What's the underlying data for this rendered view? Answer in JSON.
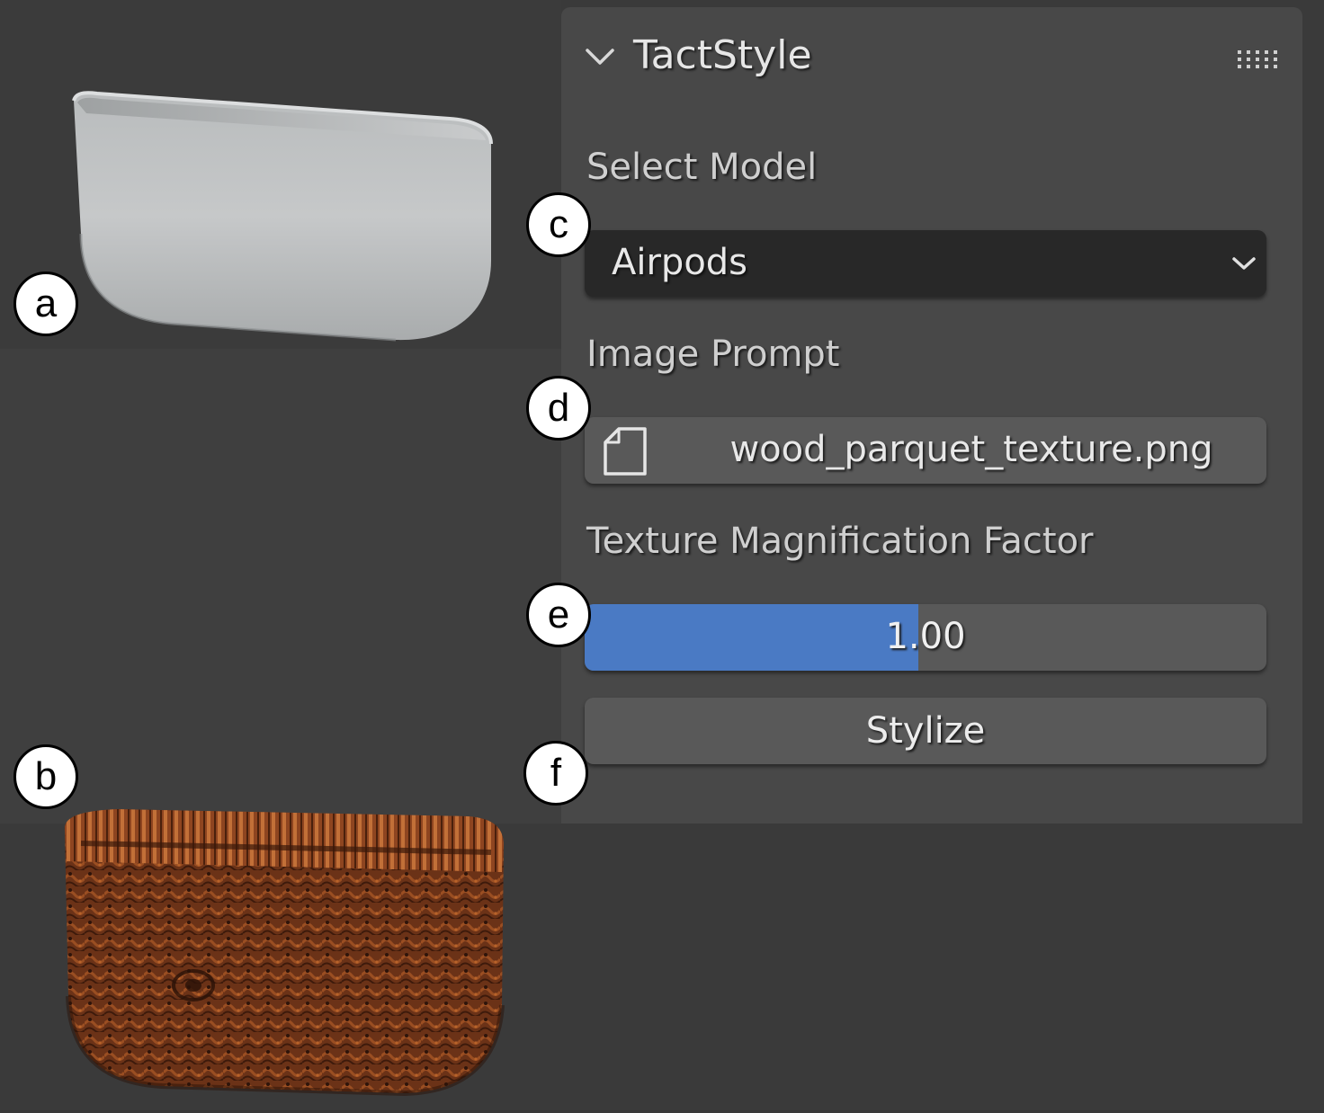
{
  "viewport": {
    "colors": {
      "plain_model": "#c4c6c6",
      "wood_model": "#7a3b1a"
    }
  },
  "panel": {
    "title": "TactStyle",
    "collapse_icon": "chevron-down-icon",
    "drag_icon": "drag-handle-icon",
    "select_model": {
      "label": "Select Model",
      "value": "Airpods",
      "dropdown_icon": "chevron-down-icon"
    },
    "image_prompt": {
      "label": "Image Prompt",
      "file_icon": "file-icon",
      "value": "wood_parquet_texture.png"
    },
    "texture_magnification": {
      "label": "Texture Magnification Factor",
      "value": "1.00",
      "fill_fraction": 0.49,
      "fill_color": "#4a7ac4"
    },
    "stylize_button": {
      "label": "Stylize"
    }
  },
  "callouts": {
    "a": "a",
    "b": "b",
    "c": "c",
    "d": "d",
    "e": "e",
    "f": "f"
  }
}
